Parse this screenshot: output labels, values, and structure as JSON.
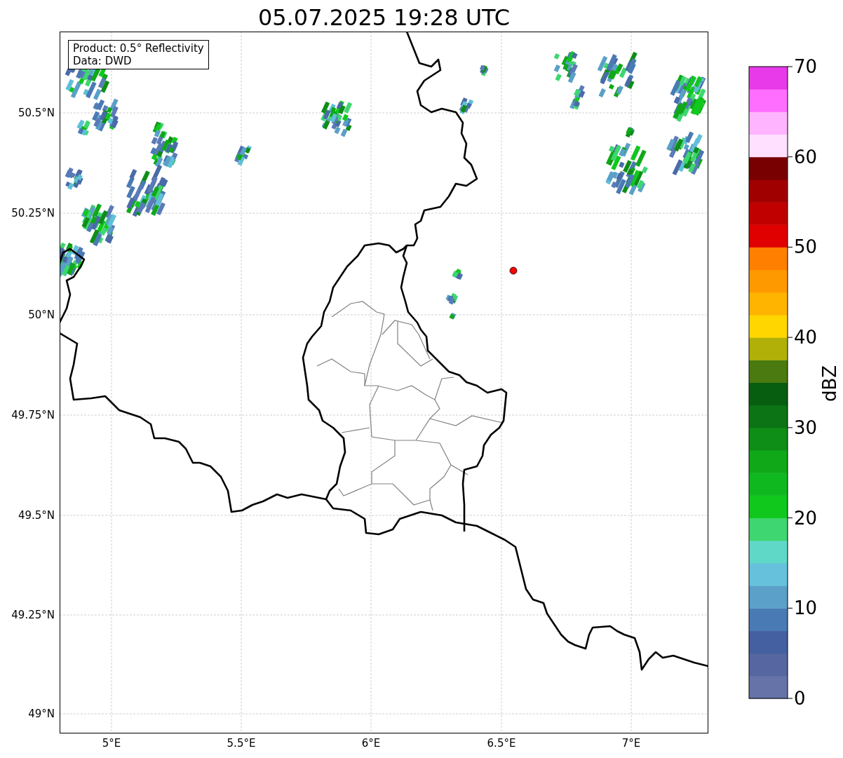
{
  "title": "05.07.2025 19:28 UTC",
  "map": {
    "info_box": [
      "Product: 0.5° Reflectivity",
      "Data: DWD"
    ],
    "lat_labels": [
      "50.5°N",
      "50.25°N",
      "50°N",
      "49.75°N",
      "49.5°N",
      "49.25°N",
      "49°N"
    ],
    "lon_labels": [
      "5°E",
      "5.5°E",
      "6°E",
      "6.5°E",
      "7°E"
    ]
  },
  "colorbar": {
    "label": "dBZ",
    "ticks": [
      "70",
      "60",
      "50",
      "40",
      "30",
      "20",
      "10",
      "0"
    ],
    "bins": [
      {
        "color": "#6673a8"
      },
      {
        "color": "#5566a0"
      },
      {
        "color": "#4460a0"
      },
      {
        "color": "#4a7ab4"
      },
      {
        "color": "#5aa0c8"
      },
      {
        "color": "#66c2dc"
      },
      {
        "color": "#60d8c8"
      },
      {
        "color": "#3ed670"
      },
      {
        "color": "#10c81c"
      },
      {
        "color": "#10b820"
      },
      {
        "color": "#10a818"
      },
      {
        "color": "#0e8e16"
      },
      {
        "color": "#0c7414"
      },
      {
        "color": "#085e10"
      },
      {
        "color": "#4a7a10"
      },
      {
        "color": "#b0b008"
      },
      {
        "color": "#ffd600"
      },
      {
        "color": "#ffb400"
      },
      {
        "color": "#ff9900"
      },
      {
        "color": "#ff7f00"
      },
      {
        "color": "#e00000"
      },
      {
        "color": "#c00000"
      },
      {
        "color": "#a00000"
      },
      {
        "color": "#780000"
      },
      {
        "color": "#ffe0ff"
      },
      {
        "color": "#ffb4ff"
      },
      {
        "color": "#ff6eff"
      },
      {
        "color": "#e83ae8"
      }
    ]
  }
}
